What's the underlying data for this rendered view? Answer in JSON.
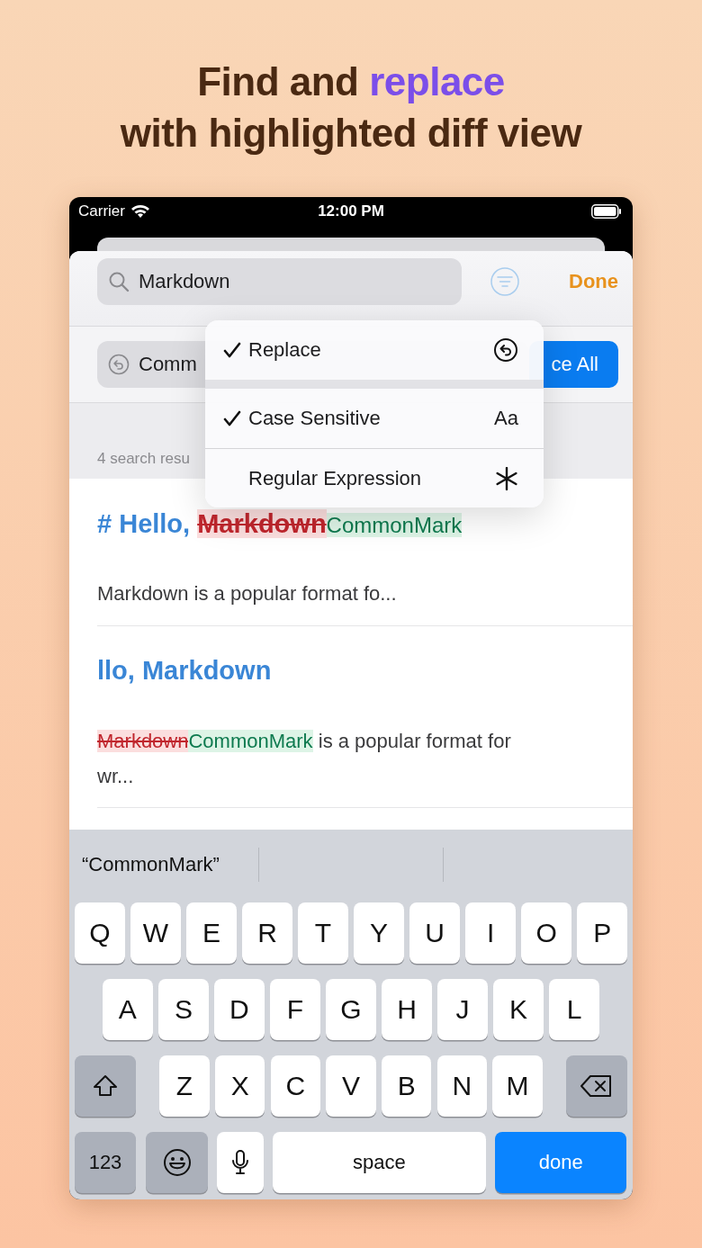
{
  "headline": {
    "lines": [
      [
        {
          "text": "Find and ",
          "accent": false
        },
        {
          "text": "replace",
          "accent": true
        }
      ],
      [
        {
          "text": "with highlighted diff view",
          "accent": false
        }
      ]
    ]
  },
  "status_bar": {
    "carrier": "Carrier",
    "time": "12:00 PM"
  },
  "search": {
    "value": "Markdown",
    "done": "Done"
  },
  "replace": {
    "value": "Comm",
    "button": "ce All"
  },
  "results_count": "4 search resu",
  "menu": [
    [
      {
        "label": "Replace",
        "selected": true,
        "kind": "undo"
      }
    ],
    [
      {
        "label": "Case Sensitive",
        "selected": true,
        "kind": "text",
        "symbol": "Aa"
      },
      {
        "label": "Regular Expression",
        "selected": false,
        "kind": "asterisk"
      }
    ]
  ],
  "results": [
    {
      "heading": [
        {
          "kind": "text",
          "text": "# Hello, "
        },
        {
          "kind": "deleted",
          "text": "Markdown"
        },
        {
          "kind": "inserted",
          "text": "CommonMark"
        }
      ],
      "snippet": [
        {
          "kind": "text",
          "text": "Markdown is a popular format fo..."
        }
      ]
    },
    {
      "heading": [
        {
          "kind": "text",
          "text": "llo, Markdown"
        }
      ],
      "snippet": [
        {
          "kind": "deleted",
          "text": "Markdown"
        },
        {
          "kind": "inserted",
          "text": "CommonMark"
        },
        {
          "kind": "text",
          "text": " is a popular format for wr..."
        }
      ]
    }
  ],
  "keyboard": {
    "suggestions": [
      "“CommonMark”"
    ],
    "rows": [
      {
        "keys": [
          {
            "kind": "letter",
            "label": "Q"
          },
          {
            "kind": "letter",
            "label": "W"
          },
          {
            "kind": "letter",
            "label": "E"
          },
          {
            "kind": "letter",
            "label": "R"
          },
          {
            "kind": "letter",
            "label": "T"
          },
          {
            "kind": "letter",
            "label": "Y"
          },
          {
            "kind": "letter",
            "label": "U"
          },
          {
            "kind": "letter",
            "label": "I"
          },
          {
            "kind": "letter",
            "label": "O"
          },
          {
            "kind": "letter",
            "label": "P"
          }
        ]
      },
      {
        "keys": [
          {
            "kind": "letter",
            "label": "A"
          },
          {
            "kind": "letter",
            "label": "S"
          },
          {
            "kind": "letter",
            "label": "D"
          },
          {
            "kind": "letter",
            "label": "F"
          },
          {
            "kind": "letter",
            "label": "G"
          },
          {
            "kind": "letter",
            "label": "H"
          },
          {
            "kind": "letter",
            "label": "J"
          },
          {
            "kind": "letter",
            "label": "K"
          },
          {
            "kind": "letter",
            "label": "L"
          }
        ]
      },
      {
        "keys": [
          {
            "kind": "shift"
          },
          {
            "kind": "letter",
            "label": "Z"
          },
          {
            "kind": "letter",
            "label": "X"
          },
          {
            "kind": "letter",
            "label": "C"
          },
          {
            "kind": "letter",
            "label": "V"
          },
          {
            "kind": "letter",
            "label": "B"
          },
          {
            "kind": "letter",
            "label": "N"
          },
          {
            "kind": "letter",
            "label": "M"
          },
          {
            "kind": "delete"
          }
        ]
      },
      {
        "keys": [
          {
            "kind": "numbers",
            "label": "123"
          },
          {
            "kind": "emoji"
          },
          {
            "kind": "mic"
          },
          {
            "kind": "space",
            "label": "space"
          },
          {
            "kind": "return",
            "label": "done"
          }
        ]
      }
    ]
  }
}
